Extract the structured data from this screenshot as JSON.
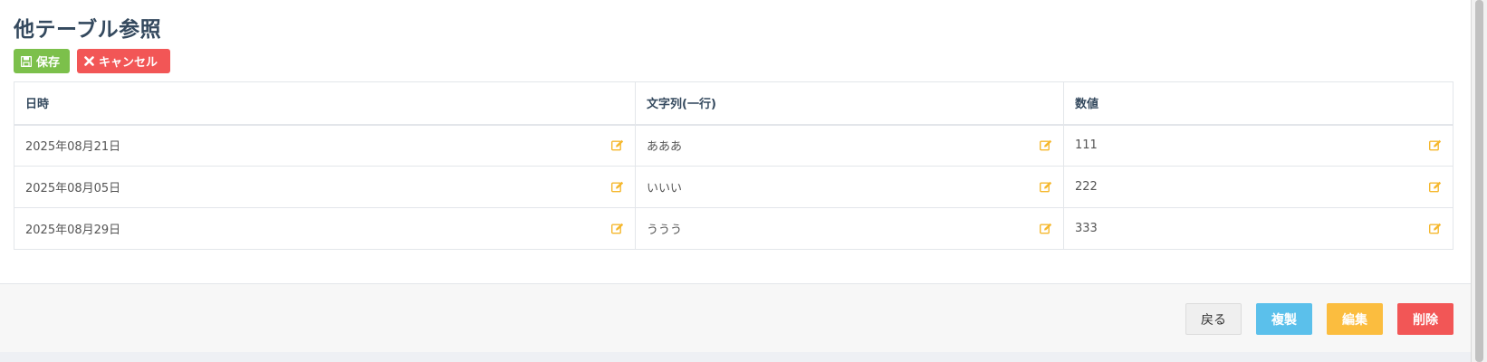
{
  "page": {
    "title": "他テーブル参照"
  },
  "toolbar": {
    "save_label": "保存",
    "cancel_label": "キャンセル"
  },
  "table": {
    "headers": [
      "日時",
      "文字列(一行)",
      "数値"
    ],
    "rows": [
      [
        "2025年08月21日",
        "あああ",
        "111"
      ],
      [
        "2025年08月05日",
        "いいい",
        "222"
      ],
      [
        "2025年08月29日",
        "ううう",
        "333"
      ]
    ]
  },
  "footer": {
    "back_label": "戻る",
    "copy_label": "複製",
    "edit_label": "編集",
    "delete_label": "削除"
  },
  "icons": {
    "save": "floppy-disk-icon",
    "cancel": "times-icon",
    "cell_edit": "pencil-square-icon"
  },
  "colors": {
    "save": "#7cc04b",
    "cancel": "#f25656",
    "edit_icon": "#f5b82e",
    "copy": "#5bc0eb",
    "edit": "#fbbd3f",
    "delete": "#f25656"
  }
}
